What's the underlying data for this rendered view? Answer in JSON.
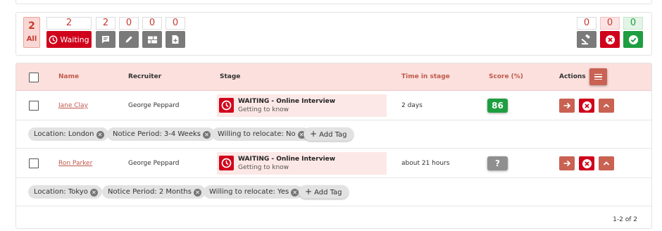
{
  "filters": {
    "all": {
      "count": "2",
      "label": "All"
    },
    "waiting": {
      "count": "2",
      "label": "Waiting",
      "icon": "clock-icon"
    },
    "comments": {
      "count": "2",
      "icon": "comment-icon"
    },
    "edit": {
      "count": "0",
      "icon": "pencil-icon"
    },
    "board": {
      "count": "0",
      "icon": "board-icon"
    },
    "document": {
      "count": "0",
      "icon": "document-add-icon"
    },
    "gavel": {
      "count": "0",
      "icon": "gavel-icon"
    },
    "rejected": {
      "count": "0",
      "icon": "x-circle-icon"
    },
    "accepted": {
      "count": "0",
      "icon": "check-circle-icon"
    }
  },
  "table": {
    "headers": {
      "name": "Name",
      "recruiter": "Recruiter",
      "stage": "Stage",
      "time": "Time in stage",
      "score": "Score (%)",
      "actions": "Actions"
    },
    "rows": [
      {
        "name": "Jane Clay",
        "recruiter": "George Peppard",
        "stage_title": "WAITING - Online Interview",
        "stage_sub": "Getting to know",
        "time": "2 days",
        "score": "86",
        "tags": [
          "Location: London",
          "Notice Period: 3-4 Weeks",
          "Willing to relocate: No"
        ],
        "add_tag": "Add Tag"
      },
      {
        "name": "Ron Parker",
        "recruiter": "George Peppard",
        "stage_title": "WAITING - Online Interview",
        "stage_sub": "Getting to know",
        "time": "about 21 hours",
        "score": "?",
        "tags": [
          "Location: Tokyo",
          "Notice Period: 2 Months",
          "Willing to relocate: Yes"
        ],
        "add_tag": "Add Tag"
      }
    ]
  },
  "pagination": "1-2 of 2",
  "colors": {
    "brand_red": "#d0021b",
    "accent_orange": "#c96252",
    "header_pink": "#fbe0dd",
    "score_green": "#1e9e40"
  }
}
